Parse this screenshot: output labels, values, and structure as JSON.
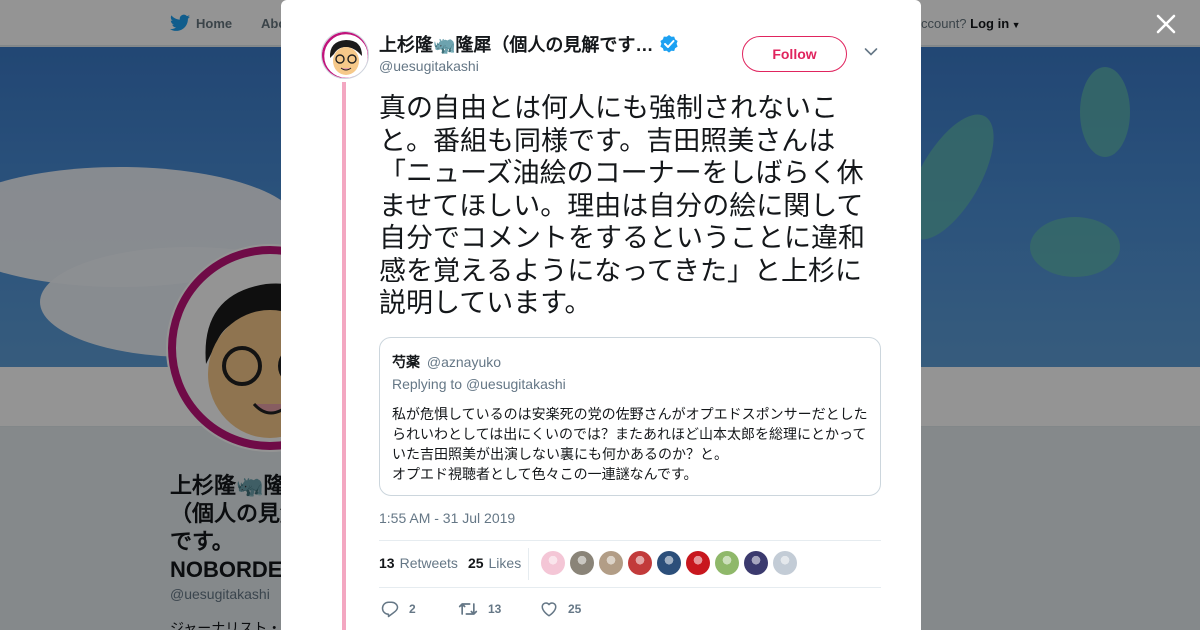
{
  "background": {
    "nav": {
      "home_label": "Home",
      "about_label": "Abo",
      "account_prompt": "ccount?",
      "login_label": "Log in"
    },
    "profile": {
      "name": "上杉隆🦏隆犀（個人の見解です。NOBORDER NEWS TOKYO 関係ありません）",
      "handle": "@uesugitakashi",
      "bio": "ジャーナリスト・"
    },
    "close_icon": "close-icon"
  },
  "tweet": {
    "author_name": "上杉隆🦏隆犀（個人の見解です…",
    "verified_icon": "verified-badge-icon",
    "handle": "@uesugitakashi",
    "follow_label": "Follow",
    "more_icon": "chevron-down-icon",
    "text": "真の自由とは何人にも強制されないこと。番組も同様です。吉田照美さんは「ニューズ油絵のコーナーをしばらく休ませてほしい。理由は自分の絵に関して自分でコメントをするということに違和感を覚えるようになってきた」と上杉に説明しています。",
    "quoted": {
      "name": "芍薬",
      "handle": "@aznayuko",
      "replying_prefix": "Replying to",
      "replying_to": "@uesugitakashi",
      "lines": [
        "私が危惧しているのは安楽死の党の佐野さんがオプエドスポンサーだとした",
        "られいわとしては出にくいのでは？またあれほど山本太郎を総理にとかって",
        "いた吉田照美が出演しない裏にも何かあるのか？と。",
        "オプエド視聴者として色々この一連謎なんです。"
      ]
    },
    "timestamp": "1:55 AM - 31 Jul 2019",
    "stats": {
      "retweets_count": "13",
      "retweets_label": "Retweets",
      "likes_count": "25",
      "likes_label": "Likes"
    },
    "liker_colors": [
      "#f4c6d6",
      "#8a8478",
      "#b29d86",
      "#c23b3b",
      "#2c4f7a",
      "#c8171e",
      "#8fb86a",
      "#3b3a6e",
      "#c3ccd6"
    ],
    "actions": {
      "reply_count": "2",
      "reply_icon": "reply-icon",
      "retweet_count": "13",
      "retweet_icon": "retweet-icon",
      "like_count": "25",
      "like_icon": "heart-icon"
    }
  },
  "colors": {
    "accent": "#e0245e",
    "thread_line": "#f3a7c1",
    "verified": "#1da1f2"
  }
}
